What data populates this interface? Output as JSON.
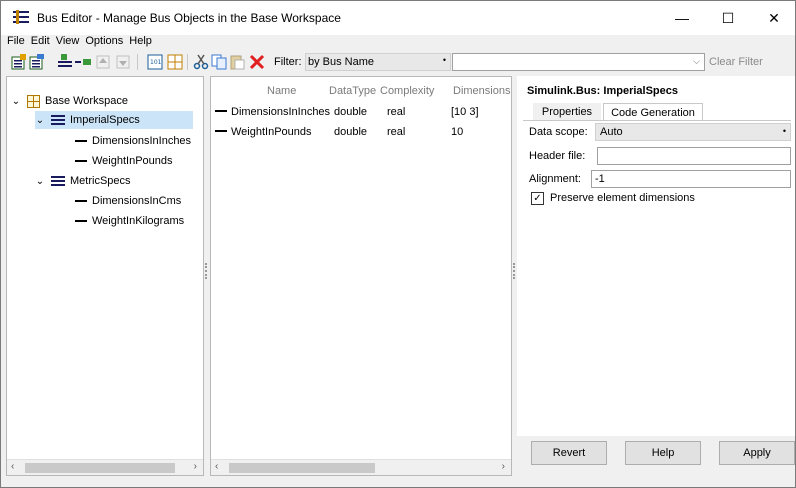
{
  "window": {
    "title": "Bus Editor - Manage Bus Objects in the Base Workspace",
    "minimize_glyph": "—",
    "maximize_glyph": "☐",
    "close_glyph": "✕"
  },
  "menu": [
    "File",
    "Edit",
    "View",
    "Options",
    "Help"
  ],
  "toolbar": {
    "filter_label": "Filter:",
    "filter_mode": "by Bus Name",
    "filter_text": "",
    "clear_filter": "Clear Filter",
    "icons": [
      "new-bus-icon",
      "new-bus-from-selection-icon",
      "insert-element-icon",
      "add-element-icon",
      "move-up-icon",
      "move-down-icon",
      "code-icon",
      "table-icon",
      "cut-icon",
      "copy-icon",
      "paste-icon",
      "delete-icon"
    ]
  },
  "tree": {
    "root": "Base Workspace",
    "buses": [
      {
        "name": "ImperialSpecs",
        "elements": [
          "DimensionsInInches",
          "WeightInPounds"
        ]
      },
      {
        "name": "MetricSpecs",
        "elements": [
          "DimensionsInCms",
          "WeightInKilograms"
        ]
      }
    ]
  },
  "table": {
    "columns": [
      "Name",
      "DataType",
      "Complexity",
      "Dimensions"
    ],
    "rows": [
      {
        "name": "DimensionsInInches",
        "datatype": "double",
        "complexity": "real",
        "dimensions": "[10 3]"
      },
      {
        "name": "WeightInPounds",
        "datatype": "double",
        "complexity": "real",
        "dimensions": "10"
      }
    ]
  },
  "properties": {
    "title": "Simulink.Bus: ImperialSpecs",
    "tabs": [
      "Properties",
      "Code Generation"
    ],
    "active_tab": "Code Generation",
    "data_scope_label": "Data scope:",
    "data_scope_value": "Auto",
    "header_file_label": "Header file:",
    "header_file_value": "",
    "alignment_label": "Alignment:",
    "alignment_value": "-1",
    "preserve_label": "Preserve element dimensions",
    "preserve_checked": true
  },
  "buttons": {
    "revert": "Revert",
    "help": "Help",
    "apply": "Apply"
  },
  "colors": {
    "selection": "#cce4f7",
    "delete_icon": "#e02020",
    "bus_icon": "#1a1a5e"
  }
}
